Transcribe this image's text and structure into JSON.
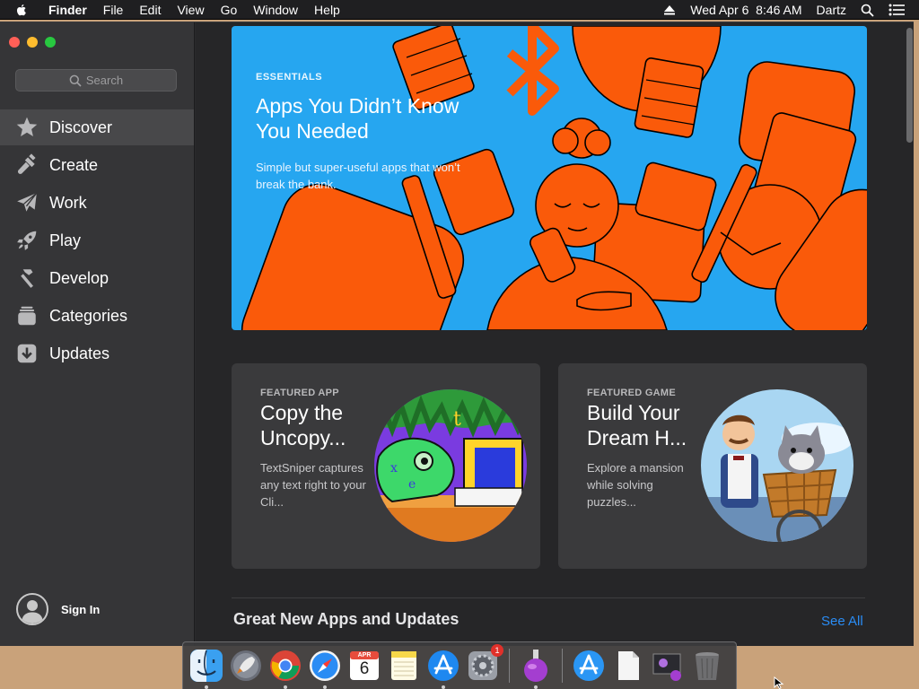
{
  "menubar": {
    "items": [
      "Finder",
      "File",
      "Edit",
      "View",
      "Go",
      "Window",
      "Help"
    ],
    "clock": "Wed Apr 6  8:46 AM",
    "user": "Dartz"
  },
  "sidebar": {
    "search_placeholder": "Search",
    "items": [
      {
        "label": "Discover",
        "icon": "star-icon",
        "active": true
      },
      {
        "label": "Create",
        "icon": "paintbrush-icon"
      },
      {
        "label": "Work",
        "icon": "paper-plane-icon"
      },
      {
        "label": "Play",
        "icon": "rocket-icon"
      },
      {
        "label": "Develop",
        "icon": "hammer-icon"
      },
      {
        "label": "Categories",
        "icon": "stack-icon"
      },
      {
        "label": "Updates",
        "icon": "download-icon"
      }
    ],
    "sign_in": "Sign In"
  },
  "hero": {
    "eyebrow": "ESSENTIALS",
    "title": "Apps You Didn’t Know You Needed",
    "description": "Simple but super-useful apps that won’t break the bank.",
    "bg_color": "#26a6f0",
    "art_color": "#fa5a0a"
  },
  "cards": [
    {
      "eyebrow": "FEATURED APP",
      "title": "Copy the Uncopy...",
      "description": "TextSniper captures any text right to your Cli..."
    },
    {
      "eyebrow": "FEATURED GAME",
      "title": "Build Your Dream H...",
      "description": "Explore a mansion while solving puzzles..."
    }
  ],
  "section": {
    "title": "Great New Apps and Updates",
    "see_all": "See All"
  },
  "dock": {
    "calendar_month": "APR",
    "calendar_day": "6",
    "settings_badge": "1",
    "icons": [
      "finder-icon",
      "launchpad-icon",
      "chrome-icon",
      "safari-icon",
      "calendar-icon",
      "notes-icon",
      "app-store-icon",
      "system-preferences-icon",
      "installer-icon",
      "app-store-folder-icon",
      "document-icon",
      "preview-icon",
      "trash-icon"
    ]
  },
  "colors": {
    "accent": "#2a8cf4",
    "sidebar_bg": "#353537",
    "content_bg": "#262628"
  }
}
